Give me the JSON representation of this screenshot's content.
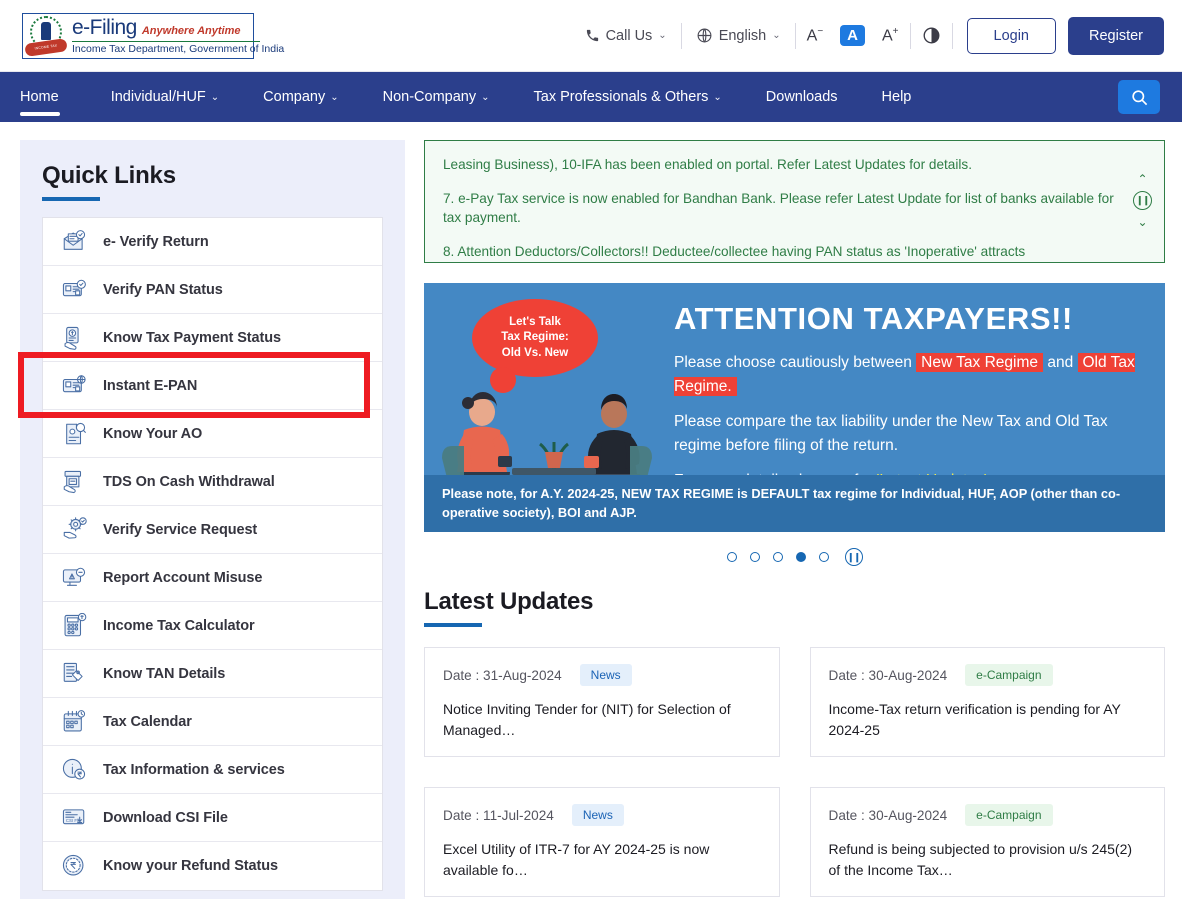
{
  "header": {
    "logo": {
      "brand": "e-Filing",
      "tagline": "Anywhere Anytime",
      "subtitle": "Income Tax Department, Government of India",
      "emblem_ribbon": "INCOME TAX DEPARTMENT"
    },
    "call_us": "Call Us",
    "language": "English",
    "font_decrease": "A",
    "font_normal": "A",
    "font_increase": "A",
    "contrast_icon": "contrast-icon",
    "login": "Login",
    "register": "Register"
  },
  "nav": {
    "items": [
      {
        "label": "Home",
        "has_caret": false,
        "active": true
      },
      {
        "label": "Individual/HUF",
        "has_caret": true,
        "active": false
      },
      {
        "label": "Company",
        "has_caret": true,
        "active": false
      },
      {
        "label": "Non-Company",
        "has_caret": true,
        "active": false
      },
      {
        "label": "Tax Professionals & Others",
        "has_caret": true,
        "active": false
      },
      {
        "label": "Downloads",
        "has_caret": false,
        "active": false
      },
      {
        "label": "Help",
        "has_caret": false,
        "active": false
      }
    ],
    "search_icon": "search-icon"
  },
  "sidebar": {
    "title": "Quick Links",
    "items": [
      {
        "label": "e- Verify Return",
        "icon": "envelope-check-icon"
      },
      {
        "label": "Verify PAN Status",
        "icon": "id-card-check-icon"
      },
      {
        "label": "Know Tax Payment Status",
        "icon": "hand-receipt-icon"
      },
      {
        "label": "Instant E-PAN",
        "icon": "id-card-globe-icon",
        "highlighted": true
      },
      {
        "label": "Know Your AO",
        "icon": "document-search-icon"
      },
      {
        "label": "TDS On Cash Withdrawal",
        "icon": "atm-hand-icon"
      },
      {
        "label": "Verify Service Request",
        "icon": "hand-gear-icon"
      },
      {
        "label": "Report Account Misuse",
        "icon": "monitor-alert-icon"
      },
      {
        "label": "Income Tax Calculator",
        "icon": "calculator-icon"
      },
      {
        "label": "Know TAN Details",
        "icon": "document-tag-icon"
      },
      {
        "label": "Tax Calendar",
        "icon": "calendar-icon"
      },
      {
        "label": "Tax Information & services",
        "icon": "info-rupee-icon"
      },
      {
        "label": "Download CSI File",
        "icon": "csi-download-icon"
      },
      {
        "label": "Know your Refund Status",
        "icon": "rupee-coin-icon"
      }
    ]
  },
  "notice": {
    "lines": [
      "Leasing Business), 10-IFA has been enabled on portal. Refer Latest Updates for details.",
      "7. e-Pay Tax service is now enabled for Bandhan Bank. Please refer Latest Update for list of banks available for tax payment.",
      "8. Attention Deductors/Collectors!! Deductee/collectee having PAN status as 'Inoperative' attracts"
    ],
    "up_icon": "chevron-up-icon",
    "pause_icon": "pause-icon",
    "down_icon": "chevron-down-icon"
  },
  "banner": {
    "bubble": "Let's Talk\nTax Regime:\nOld Vs. New",
    "bubble_line1": "Let's Talk",
    "bubble_line2": "Tax Regime:",
    "bubble_line3": "Old Vs. New",
    "heading": "ATTENTION TAXPAYERS!!",
    "p1_a": "Please choose cautiously between ",
    "p1_hl1": "New Tax Regime",
    "p1_b": " and ",
    "p1_hl2": "Old Tax Regime.",
    "p2": "Please compare the tax liability under the New Tax and Old Tax regime before filing of the return.",
    "p3_a": "For more details please refer ",
    "p3_hl": "'Latest Updates'",
    "p3_b": ".",
    "footer": "Please note, for A.Y. 2024-25, NEW TAX REGIME is DEFAULT tax regime for Individual, HUF, AOP (other than co-operative society), BOI and AJP.",
    "carousel": {
      "total_dots": 5,
      "active_index": 4,
      "pause_icon": "pause-icon"
    }
  },
  "latest_updates": {
    "title": "Latest Updates",
    "cards": [
      {
        "date": "Date : 31-Aug-2024",
        "tag": "News",
        "tag_type": "news",
        "text": "Notice Inviting Tender for (NIT) for Selection of Managed…"
      },
      {
        "date": "Date : 30-Aug-2024",
        "tag": "e-Campaign",
        "tag_type": "camp",
        "text": "Income-Tax return verification is pending for AY 2024-25"
      },
      {
        "date": "Date : 11-Jul-2024",
        "tag": "News",
        "tag_type": "news",
        "text": "Excel Utility of ITR-7 for AY 2024-25 is now available fo…"
      },
      {
        "date": "Date : 30-Aug-2024",
        "tag": "e-Campaign",
        "tag_type": "camp",
        "text": "Refund is being subjected to provision u/s 245(2) of the Income Tax…"
      }
    ]
  },
  "colors": {
    "nav_blue": "#2b3f8c",
    "accent_blue": "#1e7ae0",
    "underline_blue": "#1667b2",
    "notice_green": "#2f7d46",
    "highlight_red": "#ee1b22",
    "sidebar_bg": "#eceefa",
    "banner_blue": "#4488c4"
  }
}
